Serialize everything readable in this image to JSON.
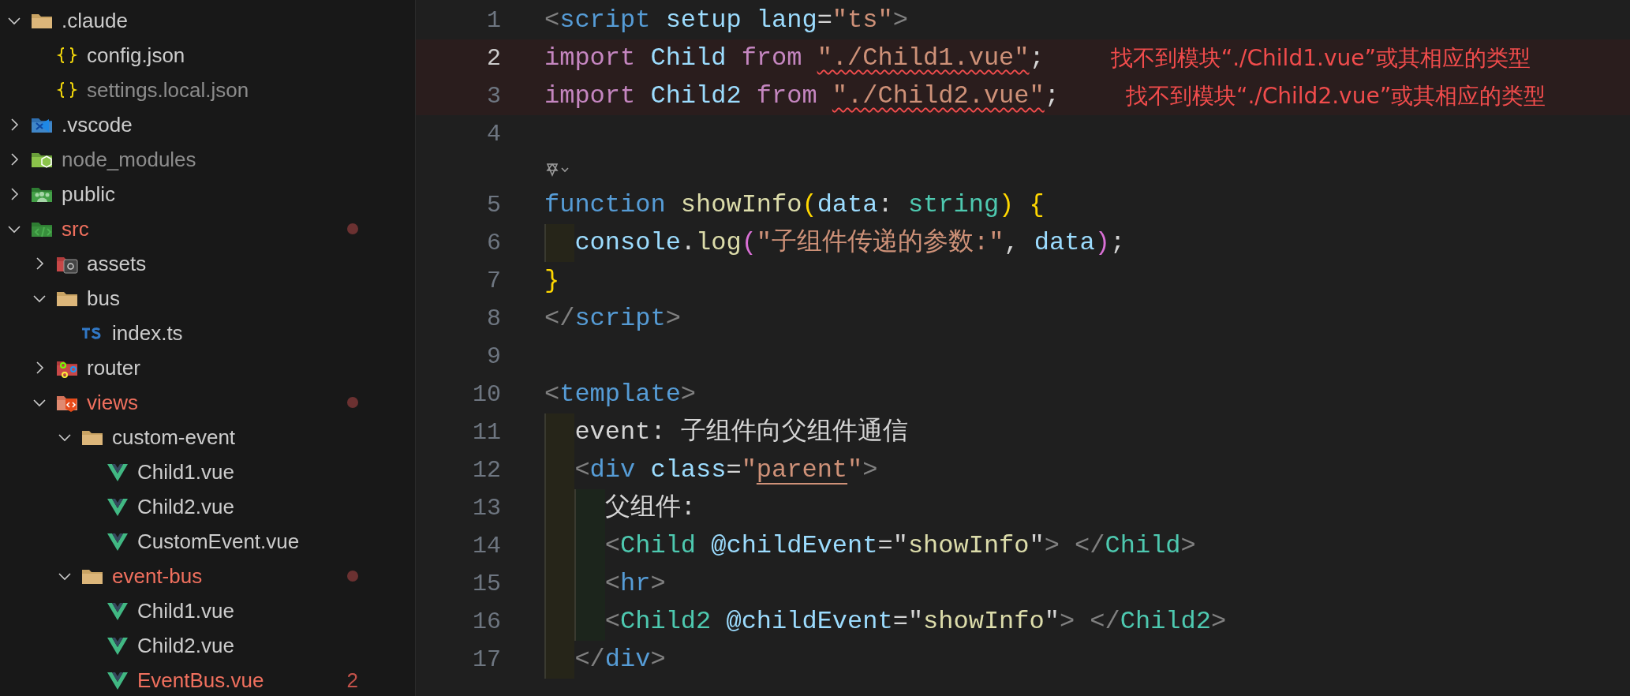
{
  "explorer": {
    "items": [
      {
        "name": ".claude",
        "kind": "folder",
        "expanded": true,
        "children": [
          {
            "name": "config.json",
            "kind": "json"
          },
          {
            "name": "settings.local.json",
            "kind": "json",
            "ignored": true
          }
        ]
      },
      {
        "name": ".vscode",
        "kind": "vscode-folder",
        "expanded": false
      },
      {
        "name": "node_modules",
        "kind": "node-folder",
        "expanded": false,
        "ignored": true
      },
      {
        "name": "public",
        "kind": "public-folder",
        "expanded": false
      },
      {
        "name": "src",
        "kind": "src-folder",
        "expanded": true,
        "modified": true,
        "dot": true,
        "children": [
          {
            "name": "assets",
            "kind": "assets-folder",
            "expanded": false
          },
          {
            "name": "bus",
            "kind": "folder",
            "expanded": true,
            "children": [
              {
                "name": "index.ts",
                "kind": "ts"
              }
            ]
          },
          {
            "name": "router",
            "kind": "router-folder",
            "expanded": false
          },
          {
            "name": "views",
            "kind": "views-folder",
            "expanded": true,
            "modified": true,
            "dot": true,
            "children": [
              {
                "name": "custom-event",
                "kind": "folder",
                "expanded": true,
                "children": [
                  {
                    "name": "Child1.vue",
                    "kind": "vue"
                  },
                  {
                    "name": "Child2.vue",
                    "kind": "vue"
                  },
                  {
                    "name": "CustomEvent.vue",
                    "kind": "vue"
                  }
                ]
              },
              {
                "name": "event-bus",
                "kind": "folder",
                "expanded": true,
                "modified": true,
                "dot": true,
                "children": [
                  {
                    "name": "Child1.vue",
                    "kind": "vue"
                  },
                  {
                    "name": "Child2.vue",
                    "kind": "vue"
                  },
                  {
                    "name": "EventBus.vue",
                    "kind": "vue",
                    "modified": true,
                    "problems": "2"
                  }
                ]
              }
            ]
          }
        ]
      }
    ]
  },
  "editor": {
    "lines": [
      {
        "number": "1",
        "current": false,
        "tokens": [
          {
            "text": "<",
            "kind": "punct"
          },
          {
            "text": "script ",
            "kind": "tag"
          },
          {
            "text": "setup lang",
            "kind": "attr"
          },
          {
            "text": "=",
            "kind": "plain"
          },
          {
            "text": "\"ts\"",
            "kind": "string"
          },
          {
            "text": ">",
            "kind": "punct"
          }
        ]
      },
      {
        "number": "2",
        "current": true,
        "error": "找不到模块“./Child1.vue”或其相应的类型",
        "tokens": [
          {
            "text": "import ",
            "kind": "keyword"
          },
          {
            "text": "Child ",
            "kind": "variable"
          },
          {
            "text": "from ",
            "kind": "keyword"
          },
          {
            "text": "\"./Child1.vue\"",
            "kind": "string",
            "squiggle": true
          },
          {
            "text": ";",
            "kind": "plain"
          }
        ]
      },
      {
        "number": "3",
        "current": false,
        "error": "找不到模块“./Child2.vue”或其相应的类型",
        "tokens": [
          {
            "text": "import ",
            "kind": "keyword"
          },
          {
            "text": "Child2 ",
            "kind": "variable"
          },
          {
            "text": "from ",
            "kind": "keyword"
          },
          {
            "text": "\"./Child2.vue\"",
            "kind": "string",
            "squiggle": true
          },
          {
            "text": ";",
            "kind": "plain"
          }
        ]
      },
      {
        "number": "4",
        "current": false
      },
      {
        "kind": "codelens"
      },
      {
        "number": "5",
        "current": false,
        "tokens": [
          {
            "text": "function ",
            "kind": "storage"
          },
          {
            "text": "showInfo",
            "kind": "function"
          },
          {
            "text": "(",
            "kind": "bracket1"
          },
          {
            "text": "data",
            "kind": "variable"
          },
          {
            "text": ": ",
            "kind": "plain"
          },
          {
            "text": "string",
            "kind": "type"
          },
          {
            "text": ") {",
            "kind": "bracket1"
          }
        ]
      },
      {
        "number": "6",
        "current": false,
        "tokens": [
          {
            "text": "  console",
            "kind": "variable"
          },
          {
            "text": ".",
            "kind": "plain"
          },
          {
            "text": "log",
            "kind": "function"
          },
          {
            "text": "(",
            "kind": "bracket2"
          },
          {
            "text": "\"子组件传递的参数:\"",
            "kind": "string"
          },
          {
            "text": ", ",
            "kind": "plain"
          },
          {
            "text": "data",
            "kind": "variable"
          },
          {
            "text": ")",
            "kind": "bracket2"
          },
          {
            "text": ";",
            "kind": "plain"
          }
        ]
      },
      {
        "number": "7",
        "current": false,
        "tokens": [
          {
            "text": "}",
            "kind": "bracket1"
          }
        ]
      },
      {
        "number": "8",
        "current": false,
        "tokens": [
          {
            "text": "</",
            "kind": "punct"
          },
          {
            "text": "script",
            "kind": "tag"
          },
          {
            "text": ">",
            "kind": "punct"
          }
        ]
      },
      {
        "number": "9",
        "current": false
      },
      {
        "number": "10",
        "current": false,
        "tokens": [
          {
            "text": "<",
            "kind": "punct"
          },
          {
            "text": "template",
            "kind": "tag"
          },
          {
            "text": ">",
            "kind": "punct"
          }
        ]
      },
      {
        "number": "11",
        "current": false,
        "tokens": [
          {
            "text": "  event: 子组件向父组件通信",
            "kind": "plain"
          }
        ]
      },
      {
        "number": "12",
        "current": false,
        "tokens": [
          {
            "text": "  <",
            "kind": "punct"
          },
          {
            "text": "div ",
            "kind": "tag"
          },
          {
            "text": "class",
            "kind": "attr"
          },
          {
            "text": "=",
            "kind": "plain"
          },
          {
            "text": "\"",
            "kind": "string"
          },
          {
            "text": "parent",
            "kind": "string",
            "underlined": true
          },
          {
            "text": "\"",
            "kind": "string"
          },
          {
            "text": ">",
            "kind": "punct"
          }
        ]
      },
      {
        "number": "13",
        "current": false,
        "tokens": [
          {
            "text": "    父组件:",
            "kind": "plain"
          }
        ]
      },
      {
        "number": "14",
        "current": false,
        "tokens": [
          {
            "text": "    <",
            "kind": "punct"
          },
          {
            "text": "Child ",
            "kind": "component"
          },
          {
            "text": "@childEvent",
            "kind": "attr"
          },
          {
            "text": "=\"",
            "kind": "plain"
          },
          {
            "text": "showInfo",
            "kind": "function"
          },
          {
            "text": "\"",
            "kind": "plain"
          },
          {
            "text": "> </",
            "kind": "punct"
          },
          {
            "text": "Child",
            "kind": "component"
          },
          {
            "text": ">",
            "kind": "punct"
          }
        ]
      },
      {
        "number": "15",
        "current": false,
        "tokens": [
          {
            "text": "    <",
            "kind": "punct"
          },
          {
            "text": "hr",
            "kind": "tag"
          },
          {
            "text": ">",
            "kind": "punct"
          }
        ]
      },
      {
        "number": "16",
        "current": false,
        "tokens": [
          {
            "text": "    <",
            "kind": "punct"
          },
          {
            "text": "Child2 ",
            "kind": "component"
          },
          {
            "text": "@childEvent",
            "kind": "attr"
          },
          {
            "text": "=\"",
            "kind": "plain"
          },
          {
            "text": "showInfo",
            "kind": "function"
          },
          {
            "text": "\"",
            "kind": "plain"
          },
          {
            "text": "> </",
            "kind": "punct"
          },
          {
            "text": "Child2",
            "kind": "component"
          },
          {
            "text": ">",
            "kind": "punct"
          }
        ]
      },
      {
        "number": "17",
        "current": false,
        "tokens": [
          {
            "text": "  </",
            "kind": "punct"
          },
          {
            "text": "div",
            "kind": "tag"
          },
          {
            "text": ">",
            "kind": "punct"
          }
        ]
      }
    ]
  }
}
